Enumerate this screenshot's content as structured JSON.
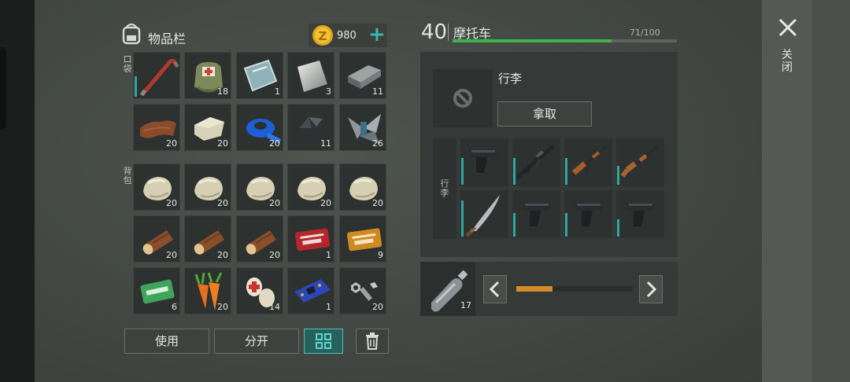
{
  "inventory": {
    "title": "物品栏",
    "coins": "980",
    "pocket_label": "口袋",
    "backpack_label": "背包",
    "pocket_slots": [
      {
        "icon": "crowbar-icon",
        "count": ""
      },
      {
        "icon": "medical-bag-icon",
        "count": "18"
      },
      {
        "icon": "glass-sheet-icon",
        "count": "1"
      },
      {
        "icon": "metal-sheet-icon",
        "count": "3"
      },
      {
        "icon": "iron-ingot-icon",
        "count": "11"
      },
      {
        "icon": "leather-icon",
        "count": "20"
      },
      {
        "icon": "limestone-icon",
        "count": "20"
      },
      {
        "icon": "duct-tape-icon",
        "count": "20"
      },
      {
        "icon": "coal-ore-icon",
        "count": "11"
      },
      {
        "icon": "scrap-metal-icon",
        "count": "26"
      }
    ],
    "backpack_slots": [
      {
        "icon": "stone-icon",
        "count": "20"
      },
      {
        "icon": "stone-icon",
        "count": "20"
      },
      {
        "icon": "stone-icon",
        "count": "20"
      },
      {
        "icon": "stone-icon",
        "count": "20"
      },
      {
        "icon": "stone-icon",
        "count": "20"
      },
      {
        "icon": "log-icon",
        "count": "20"
      },
      {
        "icon": "log-icon",
        "count": "20"
      },
      {
        "icon": "log-icon",
        "count": "20"
      },
      {
        "icon": "combat-coupon-icon",
        "count": "1"
      },
      {
        "icon": "gold-coupon-icon",
        "count": "9"
      },
      {
        "icon": "ration-coupon-icon",
        "count": "6"
      },
      {
        "icon": "carrot-icon",
        "count": "20"
      },
      {
        "icon": "bandage-icon",
        "count": "14"
      },
      {
        "icon": "circuit-board-icon",
        "count": "1"
      },
      {
        "icon": "nuts-bolts-icon",
        "count": "20"
      }
    ],
    "buttons": {
      "use": "使用",
      "split": "分开"
    }
  },
  "vehicle": {
    "level": "40",
    "name": "摩托车",
    "hp": "71/100",
    "hp_fraction": 0.71,
    "luggage_title": "行李",
    "take_label": "拿取",
    "luggage_side_label": "行李",
    "weapons": [
      {
        "icon": "pistol-icon",
        "dots": [
          "g",
          "g",
          "g",
          "g"
        ]
      },
      {
        "icon": "assault-rifle-icon",
        "dots": [
          "g",
          "g",
          "g",
          "g"
        ]
      },
      {
        "icon": "ak-rifle-icon",
        "dots": [
          "p",
          "p",
          "p"
        ]
      },
      {
        "icon": "shotgun-icon",
        "dots": [
          "g",
          "g",
          "g",
          "g"
        ]
      },
      {
        "icon": "machete-icon",
        "dots": []
      },
      {
        "icon": "pistol-icon",
        "dots": [
          "g",
          "g",
          "g",
          "g"
        ]
      },
      {
        "icon": "pistol-icon",
        "dots": [
          "g",
          "g",
          "g",
          "g"
        ]
      },
      {
        "icon": "pistol-icon",
        "dots": [
          "g",
          "g",
          "g",
          "g"
        ]
      }
    ],
    "fuel_count": "17",
    "fuel_fraction": 0.31
  },
  "close_label": "关闭"
}
